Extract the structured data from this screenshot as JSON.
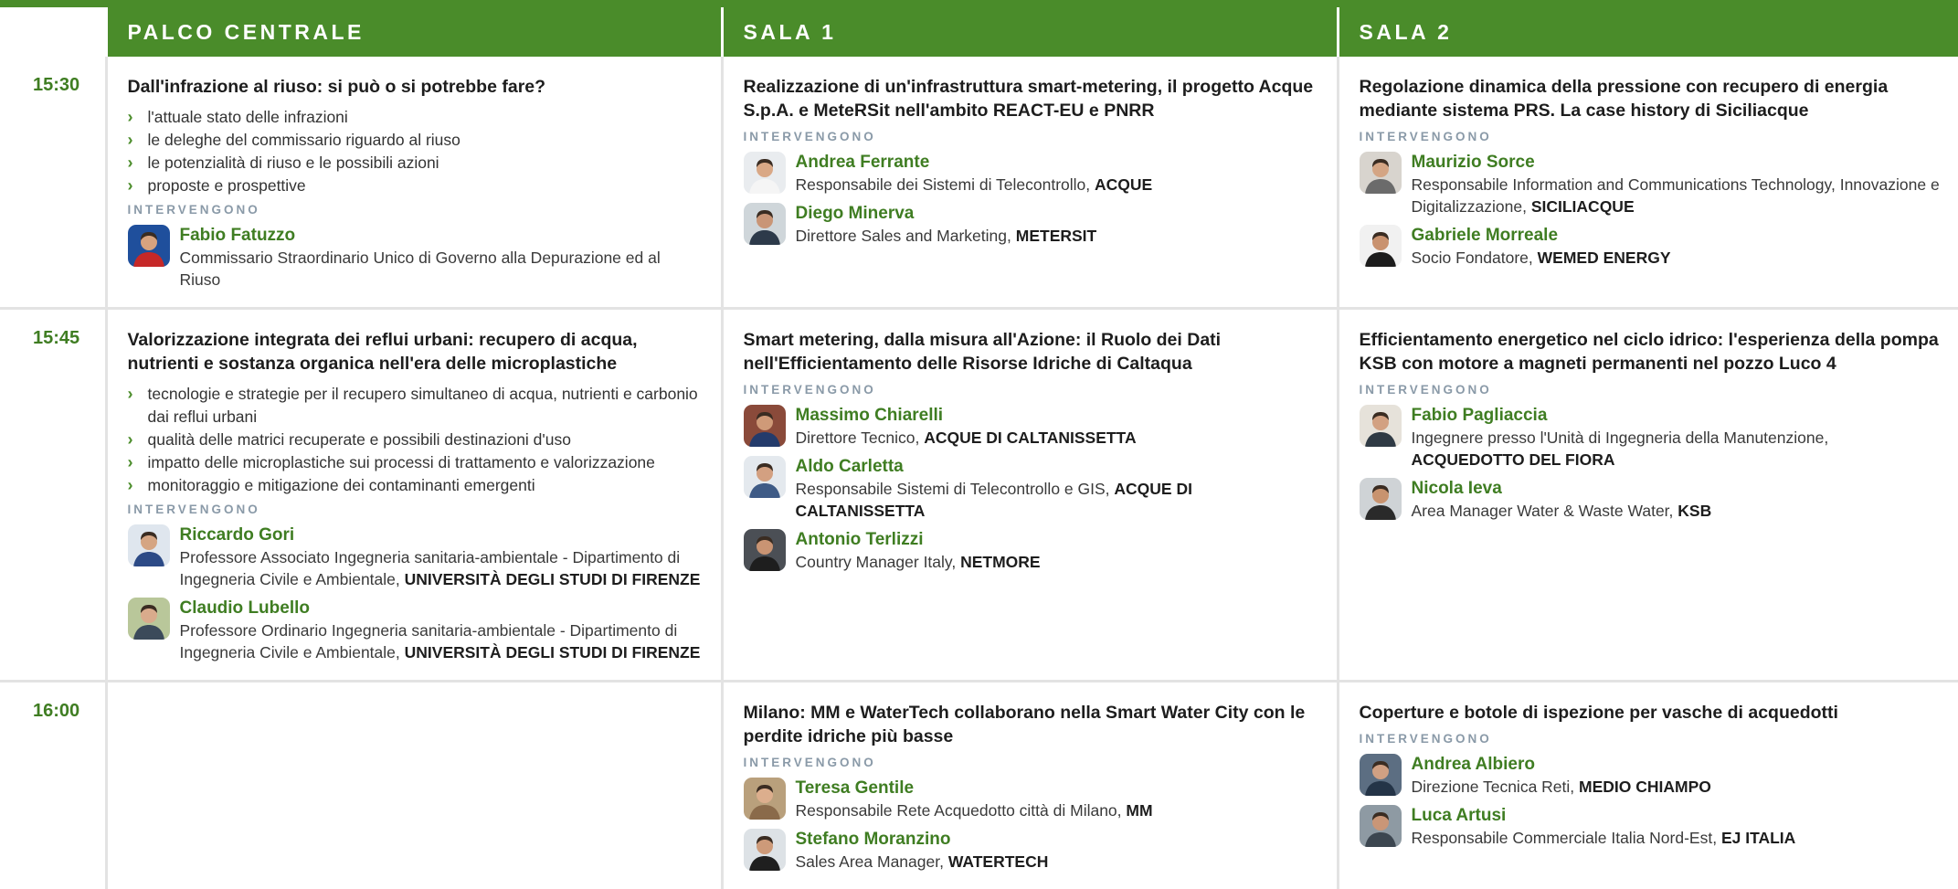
{
  "rooms": [
    "PALCO CENTRALE",
    "SALA 1",
    "SALA 2"
  ],
  "intervengono_label": "INTERVENGONO",
  "slots": [
    {
      "time": "15:30",
      "sessions": [
        {
          "title": "Dall'infrazione al riuso: si può o si potrebbe fare?",
          "bullets": [
            "l'attuale stato delle infrazioni",
            "le deleghe del commissario riguardo al riuso",
            "le potenzialità di riuso e le possibili azioni",
            "proposte e prospettive"
          ],
          "speakers": [
            {
              "name": "Fabio Fatuzzo",
              "role": "Commissario Straordinario Unico di Governo alla Depurazione ed al Riuso",
              "org": "",
              "avatar_color": "#1f4f9c",
              "shirt_color": "#c62828",
              "skin": "#d7a37f"
            }
          ]
        },
        {
          "title": "Realizzazione di un'infrastruttura smart-metering, il progetto Acque S.p.A. e MeteRSit nell'ambito REACT-EU e PNRR",
          "bullets": [],
          "speakers": [
            {
              "name": "Andrea Ferrante",
              "role": "Responsabile dei Sistemi di Telecontrollo,",
              "org": "ACQUE",
              "avatar_color": "#e9ecef",
              "shirt_color": "#f5f5f5",
              "skin": "#d9a886"
            },
            {
              "name": "Diego Minerva",
              "role": "Direttore Sales and Marketing,",
              "org": "METERSIT",
              "avatar_color": "#cfd6da",
              "shirt_color": "#2d3a4a",
              "skin": "#c99576"
            }
          ]
        },
        {
          "title": "Regolazione dinamica della pressione con recupero di energia mediante sistema PRS. La case history di Siciliacque",
          "bullets": [],
          "speakers": [
            {
              "name": "Maurizio Sorce",
              "role": "Responsabile Information and Communications Technology, Innovazione e Digitalizzazione,",
              "org": "SICILIACQUE",
              "avatar_color": "#d8d4ce",
              "shirt_color": "#6b6b6b",
              "skin": "#d4a584"
            },
            {
              "name": "Gabriele Morreale",
              "role": "Socio Fondatore,",
              "org": "WEMED ENERGY",
              "avatar_color": "#f1f1f1",
              "shirt_color": "#1c1c1c",
              "skin": "#c9926f"
            }
          ]
        }
      ]
    },
    {
      "time": "15:45",
      "sessions": [
        {
          "title": "Valorizzazione integrata dei reflui urbani: recupero di acqua, nutrienti e sostanza organica nell'era delle microplastiche",
          "bullets": [
            "tecnologie e strategie per il recupero simultaneo di acqua, nutrienti e carbonio dai reflui urbani",
            "qualità delle matrici recuperate e possibili destinazioni d'uso",
            "impatto delle microplastiche sui processi di trattamento e valorizzazione",
            "monitoraggio e mitigazione dei contaminanti emergenti"
          ],
          "speakers": [
            {
              "name": "Riccardo Gori",
              "role": "Professore Associato Ingegneria sanitaria-ambientale - Dipartimento di Ingegneria Civile e Ambientale,",
              "org": "UNIVERSITÀ DEGLI STUDI DI FIRENZE",
              "avatar_color": "#dfe6ee",
              "shirt_color": "#2c4a86",
              "skin": "#d5a583"
            },
            {
              "name": "Claudio Lubello",
              "role": "Professore Ordinario Ingegneria sanitaria-ambientale - Dipartimento di Ingegneria Civile e Ambientale,",
              "org": "UNIVERSITÀ DEGLI STUDI DI FIRENZE",
              "avatar_color": "#b9c79a",
              "shirt_color": "#3b4a5a",
              "skin": "#d9ab8c"
            }
          ]
        },
        {
          "title": "Smart metering, dalla misura all'Azione: il Ruolo dei Dati nell'Efficientamento delle Risorse Idriche di Caltaqua",
          "bullets": [],
          "speakers": [
            {
              "name": "Massimo Chiarelli",
              "role": "Direttore Tecnico,",
              "org": "ACQUE DI CALTANISSETTA",
              "avatar_color": "#8a4a3a",
              "shirt_color": "#243b6b",
              "skin": "#cf9a78"
            },
            {
              "name": "Aldo Carletta",
              "role": "Responsabile Sistemi di Telecontrollo e GIS,",
              "org": "ACQUE DI CALTANISSETTA",
              "avatar_color": "#e4e9ee",
              "shirt_color": "#3f5b86",
              "skin": "#d3a081"
            },
            {
              "name": "Antonio Terlizzi",
              "role": "Country Manager Italy,",
              "org": "NETMORE",
              "avatar_color": "#4b4f55",
              "shirt_color": "#1e1e1e",
              "skin": "#c99473"
            }
          ]
        },
        {
          "title": "Efficientamento energetico nel ciclo idrico: l'esperienza della pompa KSB con motore a magneti permanenti nel pozzo Luco 4",
          "bullets": [],
          "speakers": [
            {
              "name": "Fabio Pagliaccia",
              "role": "Ingegnere presso l'Unità di Ingegneria della Manutenzione,",
              "org": "ACQUEDOTTO DEL FIORA",
              "avatar_color": "#e6e2da",
              "shirt_color": "#2f3a44",
              "skin": "#d2a182"
            },
            {
              "name": "Nicola Ieva",
              "role": "Area Manager Water & Waste Water,",
              "org": "KSB",
              "avatar_color": "#cfd3d6",
              "shirt_color": "#2a2a2a",
              "skin": "#c8936f"
            }
          ]
        }
      ]
    },
    {
      "time": "16:00",
      "sessions": [
        null,
        {
          "title": "Milano: MM e WaterTech collaborano nella Smart Water City con le perdite idriche più basse",
          "bullets": [],
          "speakers": [
            {
              "name": "Teresa Gentile",
              "role": "Responsabile Rete Acquedotto città di Milano,",
              "org": "MM",
              "avatar_color": "#b9a07c",
              "shirt_color": "#8a6a4a",
              "skin": "#dcae8d"
            },
            {
              "name": "Stefano Moranzino",
              "role": "Sales Area Manager,",
              "org": "WATERTECH",
              "avatar_color": "#dde2e6",
              "shirt_color": "#1f1f1f",
              "skin": "#cd9a79"
            }
          ]
        },
        {
          "title": "Coperture e botole di ispezione per vasche di acquedotti",
          "bullets": [],
          "speakers": [
            {
              "name": "Andrea Albiero",
              "role": "Direzione Tecnica Reti,",
              "org": "MEDIO CHIAMPO",
              "avatar_color": "#5c6e82",
              "shirt_color": "#243447",
              "skin": "#d0a083"
            },
            {
              "name": "Luca Artusi",
              "role": "Responsabile Commerciale Italia Nord-Est,",
              "org": "EJ ITALIA",
              "avatar_color": "#8e9aa3",
              "shirt_color": "#3c4650",
              "skin": "#c99677"
            }
          ]
        }
      ]
    }
  ],
  "colors": {
    "brand_green": "#4a8c2a",
    "name_green": "#3f7d22",
    "label_gray": "#8a9aa8",
    "grid": "#e3e3e3"
  }
}
